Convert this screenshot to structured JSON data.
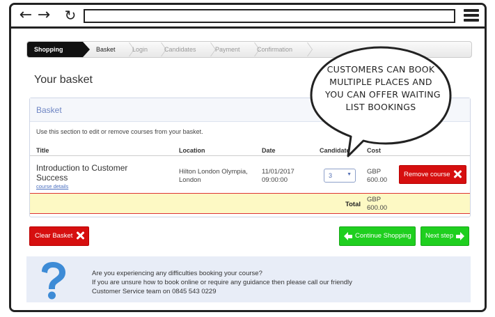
{
  "browser": {
    "back_glyph": "←",
    "forward_glyph": "→",
    "reload_glyph": "↻"
  },
  "steps": [
    {
      "label": "Shopping basket"
    },
    {
      "label": "Basket"
    },
    {
      "label": "Login"
    },
    {
      "label": "Candidates"
    },
    {
      "label": "Payment"
    },
    {
      "label": "Confirmation"
    }
  ],
  "page": {
    "title": "Your basket"
  },
  "basket": {
    "title": "Basket",
    "description": "Use this section to edit or remove courses from your basket.",
    "columns": {
      "title": "Title",
      "location": "Location",
      "date": "Date",
      "candidates": "Candidates",
      "cost": "Cost"
    },
    "item": {
      "title": "Introduction to Customer Success",
      "link": "course details",
      "location": "Hilton London Olympia, London",
      "date": "11/01/2017 09:00:00",
      "quantity": "3",
      "price_currency": "GBP",
      "price_amount": "600.00",
      "remove_label": "Remove course"
    },
    "total_label": "Total",
    "total_currency": "GBP",
    "total_amount": "600.00"
  },
  "actions": {
    "clear_label": "Clear Basket",
    "continue_label": "Continue Shopping",
    "next_label": "Next step"
  },
  "help": {
    "line1": "Are you experiencing any difficulties booking your course?",
    "line2": "If you are unsure how to book online or require any guidance then please call our friendly",
    "line3": "Customer Service team on 0845 543 0229"
  },
  "callout": {
    "line1": "CUSTOMERS CAN BOOK",
    "line2": "MULTIPLE PLACES AND",
    "line3": "YOU CAN OFFER WAITING",
    "line4": "LIST BOOKINGS"
  },
  "colors": {
    "danger": "#d60f0f",
    "success": "#1fcf1f",
    "total_row": "#fdf9c4",
    "help_bg": "#e8edf7",
    "help_icon": "#3d8bd6"
  }
}
